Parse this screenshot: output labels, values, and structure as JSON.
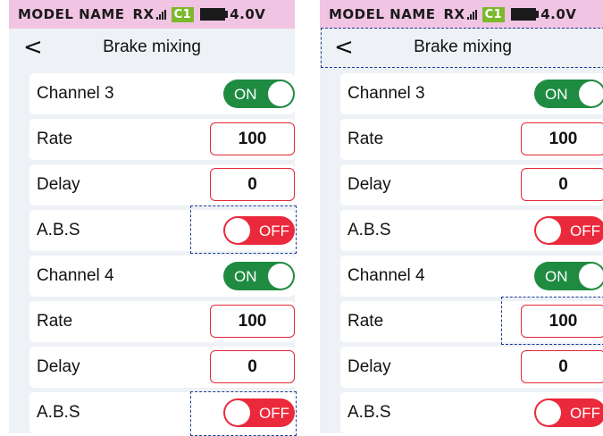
{
  "status_bar": {
    "model_name": "MODEL NAME",
    "receiver_label": "RX",
    "channel_badge": "C1",
    "voltage": "4.0V"
  },
  "header": {
    "back_glyph": "<",
    "title": "Brake mixing"
  },
  "rows": [
    {
      "label": "Channel 3",
      "type": "toggle",
      "value": "ON"
    },
    {
      "label": "Rate",
      "type": "value",
      "value": "100"
    },
    {
      "label": "Delay",
      "type": "value",
      "value": "0"
    },
    {
      "label": "A.B.S",
      "type": "toggle",
      "value": "OFF"
    },
    {
      "label": "Channel 4",
      "type": "toggle",
      "value": "ON"
    },
    {
      "label": "Rate",
      "type": "value",
      "value": "100"
    },
    {
      "label": "Delay",
      "type": "value",
      "value": "0"
    },
    {
      "label": "A.B.S",
      "type": "toggle",
      "value": "OFF"
    }
  ],
  "colors": {
    "status_bar_bg": "#f1c4e3",
    "channel_badge_bg": "#7cb92c",
    "toggle_on": "#1f8b41",
    "toggle_off": "#ea2a3c",
    "value_border": "#e3283a",
    "highlight_dash": "#1c3d8f"
  },
  "icons": {
    "signal": "signal-bars-icon",
    "battery": "battery-icon",
    "back": "chevron-left-icon"
  }
}
